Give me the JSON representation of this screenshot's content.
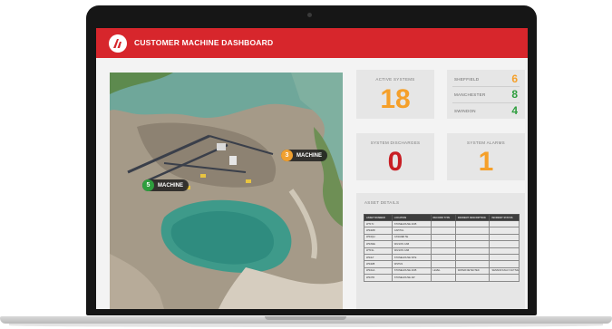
{
  "header": {
    "title": "CUSTOMER MACHINE DASHBOARD",
    "logo_icon": "company-logo-icon",
    "color": "#d7262c"
  },
  "map": {
    "markers": [
      {
        "number": "5",
        "label": "MACHINE",
        "color": "#2e9e3e"
      },
      {
        "number": "3",
        "label": "MACHINE",
        "color": "#f0a030"
      }
    ]
  },
  "active_systems": {
    "title": "ACTIVE SYSTEMS",
    "value": "18",
    "color": "#f5a02a"
  },
  "sites": [
    {
      "name": "SHEFFIELD",
      "value": "6",
      "color": "#f5a02a"
    },
    {
      "name": "MANCHESTER",
      "value": "8",
      "color": "#2e9e3e"
    },
    {
      "name": "SWINDON",
      "value": "4",
      "color": "#2e9e3e"
    }
  ],
  "system_discharges": {
    "title": "SYSTEM DISCHARGES",
    "value": "0",
    "color": "#c81e24"
  },
  "system_alarms": {
    "title": "SYSTEM ALARMS",
    "value": "1",
    "color": "#f5a02a"
  },
  "asset_details": {
    "title": "ASSET DETAILS",
    "columns": [
      "ASSET NUMBER",
      "LOCATION",
      "RECORD TYPE",
      "INCIDENT DESCRIPTION",
      "INCIDENT STATUS"
    ],
    "rows": [
      [
        "WT1TJ",
        "STONEHOUSE 4345",
        "",
        "",
        ""
      ],
      [
        "WS4MR",
        "CAPITAL",
        "",
        "",
        ""
      ],
      [
        "WS4QH",
        "CASHIER 5E",
        "",
        "",
        ""
      ],
      [
        "WS4WE",
        "WILSON CAB",
        "",
        "",
        ""
      ],
      [
        "WT1SL",
        "WILSON CAB",
        "",
        "",
        ""
      ],
      [
        "WS4LT",
        "STONEHOUSE SITE",
        "",
        "",
        ""
      ],
      [
        "WS4M8",
        "WSTM1",
        "",
        "",
        ""
      ],
      [
        "WS4GA",
        "STONEHOUSE 4345",
        "LEVEL",
        "WATER DETECTED",
        "SENSOR FAULT ACTIVE"
      ],
      [
        "WS4TR",
        "STONEHOUSE 4W",
        "",
        "",
        ""
      ]
    ]
  }
}
